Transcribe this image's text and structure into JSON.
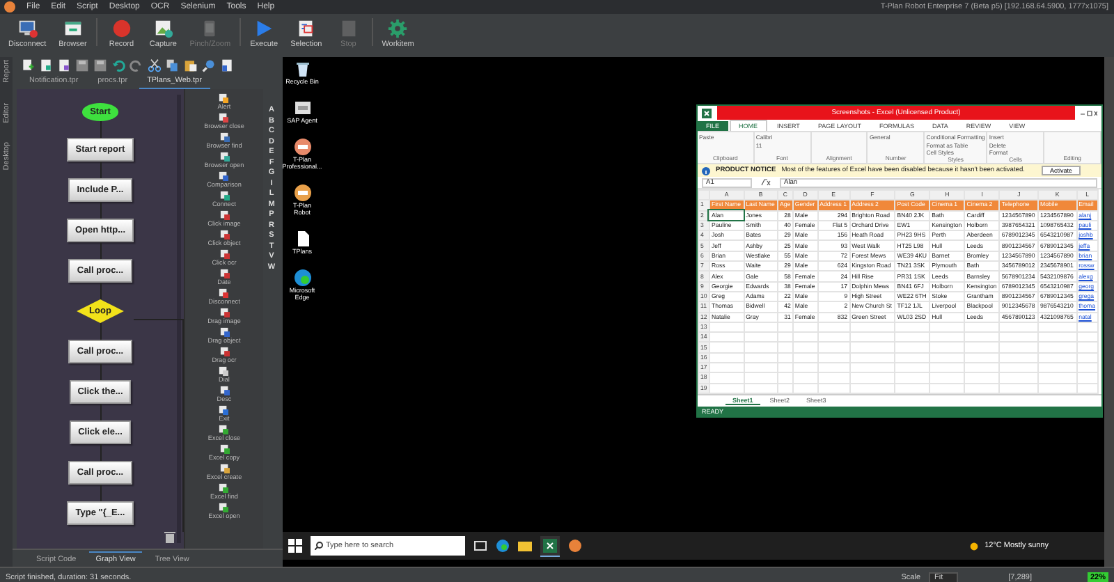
{
  "menu": [
    "File",
    "Edit",
    "Script",
    "Desktop",
    "OCR",
    "Selenium",
    "Tools",
    "Help"
  ],
  "window_title": "T-Plan Robot Enterprise 7 (Beta p5) [192.168.64.5900, 1777x1075]",
  "toolbar": [
    {
      "label": "Disconnect",
      "disabled": false
    },
    {
      "label": "Browser",
      "disabled": false
    },
    {
      "label": "Record",
      "disabled": false
    },
    {
      "label": "Capture",
      "disabled": false
    },
    {
      "label": "Pinch/Zoom",
      "disabled": true
    },
    {
      "label": "Execute",
      "disabled": false
    },
    {
      "label": "Selection",
      "disabled": false
    },
    {
      "label": "Stop",
      "disabled": true
    },
    {
      "label": "Workitem",
      "disabled": false
    }
  ],
  "side_strip": [
    "Report",
    "Editor",
    "Desktop"
  ],
  "file_tabs": [
    {
      "label": "Notification.tpr",
      "selected": false
    },
    {
      "label": "procs.tpr",
      "selected": false
    },
    {
      "label": "TPlans_Web.tpr",
      "selected": true
    }
  ],
  "flow": [
    {
      "kind": "start",
      "label": "Start"
    },
    {
      "kind": "step",
      "label": "Start report"
    },
    {
      "kind": "step",
      "label": "Include P..."
    },
    {
      "kind": "step",
      "label": "Open http..."
    },
    {
      "kind": "step",
      "label": "Call proc..."
    },
    {
      "kind": "loop",
      "label": "Loop"
    },
    {
      "kind": "step",
      "label": "Call proc..."
    },
    {
      "kind": "step",
      "label": "Click the..."
    },
    {
      "kind": "step",
      "label": "Click ele..."
    },
    {
      "kind": "step",
      "label": "Call proc..."
    },
    {
      "kind": "step",
      "label": "Type \"{_E..."
    }
  ],
  "palette": [
    "Alert",
    "Browser close",
    "Browser find",
    "Browser open",
    "Comparison",
    "Connect",
    "Click image",
    "Click object",
    "Click ocr",
    "Date",
    "Disconnect",
    "Drag image",
    "Drag object",
    "Drag ocr",
    "Dial",
    "Desc",
    "Exit",
    "Excel close",
    "Excel copy",
    "Excel create",
    "Excel find",
    "Excel open"
  ],
  "index_letters": [
    "A",
    "B",
    "C",
    "D",
    "E",
    "F",
    "G",
    "I",
    "L",
    "M",
    "P",
    "R",
    "S",
    "T",
    "V",
    "W"
  ],
  "view_tabs": [
    {
      "label": "Script Code",
      "selected": false
    },
    {
      "label": "Graph View",
      "selected": true
    },
    {
      "label": "Tree View",
      "selected": false
    }
  ],
  "status": "Script finished, duration: 31 seconds.",
  "remote_status": {
    "scale_label": "Scale",
    "scale_value": "Fit",
    "coords": "[7,289]",
    "zoom": "22%"
  },
  "desktop_icons": [
    "Recycle Bin",
    "SAP Agent",
    "T-Plan Professional...",
    "T-Plan Robot",
    "TPlans",
    "Microsoft Edge"
  ],
  "excel": {
    "title": "Screenshots - Excel (Unlicensed Product)",
    "ribbon_tabs": [
      {
        "label": "FILE",
        "selected": false
      },
      {
        "label": "HOME",
        "selected": true
      },
      {
        "label": "INSERT",
        "selected": false
      },
      {
        "label": "PAGE LAYOUT",
        "selected": false
      },
      {
        "label": "FORMULAS",
        "selected": false
      },
      {
        "label": "DATA",
        "selected": false
      },
      {
        "label": "REVIEW",
        "selected": false
      },
      {
        "label": "VIEW",
        "selected": false
      }
    ],
    "ribbon_groups": [
      {
        "label": "Clipboard",
        "items": [
          "Paste"
        ]
      },
      {
        "label": "Font",
        "items": [
          "Calibri",
          "11"
        ]
      },
      {
        "label": "Alignment"
      },
      {
        "label": "Number",
        "items": [
          "General"
        ]
      },
      {
        "label": "Styles",
        "items": [
          "Conditional Formatting",
          "Format as Table",
          "Cell Styles"
        ]
      },
      {
        "label": "Cells",
        "items": [
          "Insert",
          "Delete",
          "Format"
        ]
      },
      {
        "label": "Editing"
      }
    ],
    "notice": {
      "title": "PRODUCT NOTICE",
      "message": "Most of the features of Excel have been disabled because it hasn't been activated.",
      "button": "Activate"
    },
    "name_box": "A1",
    "formula": "Alan",
    "column_letters": [
      "A",
      "B",
      "C",
      "D",
      "E",
      "F",
      "G",
      "H",
      "I",
      "J",
      "K",
      "L"
    ],
    "rows": [
      [
        "First Name",
        "Last Name",
        "Age",
        "Gender",
        "Address 1",
        "Address 2",
        "Post Code",
        "Cinema 1",
        "Cinema 2",
        "Telephone",
        "Mobile",
        "Email"
      ],
      [
        "Alan",
        "Jones",
        "28",
        "Male",
        "294",
        "Brighton Road",
        "BN40 2JK",
        "Bath",
        "Cardiff",
        "1234567890",
        "1234567890",
        "alanj"
      ],
      [
        "Pauline",
        "Smith",
        "40",
        "Female",
        "Flat 5",
        "Orchard Drive",
        "EW1",
        "Kensington",
        "Holborn",
        "3987654321",
        "1098765432",
        "pauli"
      ],
      [
        "Josh",
        "Bates",
        "29",
        "Male",
        "156",
        "Heath Road",
        "PH23 9HS",
        "Perth",
        "Aberdeen",
        "6789012345",
        "6543210987",
        "joshb"
      ],
      [
        "Jeff",
        "Ashby",
        "25",
        "Male",
        "93",
        "West Walk",
        "HT25 L98",
        "Hull",
        "Leeds",
        "8901234567",
        "6789012345",
        "jeffa"
      ],
      [
        "Brian",
        "Westlake",
        "55",
        "Male",
        "72",
        "Forest Mews",
        "WE39 4KU",
        "Barnet",
        "Bromley",
        "1234567890",
        "1234567890",
        "brian"
      ],
      [
        "Ross",
        "Waite",
        "29",
        "Male",
        "624",
        "Kingston Road",
        "TN21 3SK",
        "Plymouth",
        "Bath",
        "3456789012",
        "2345678901",
        "rossw"
      ],
      [
        "Alex",
        "Gale",
        "58",
        "Female",
        "24",
        "Hill Rise",
        "PR31 1SK",
        "Leeds",
        "Barnsley",
        "5678901234",
        "5432109876",
        "alexg"
      ],
      [
        "Georgie",
        "Edwards",
        "38",
        "Female",
        "17",
        "Dolphin Mews",
        "BN41 6FJ",
        "Holborn",
        "Kensington",
        "6789012345",
        "6543210987",
        "georg"
      ],
      [
        "Greg",
        "Adams",
        "22",
        "Male",
        "9",
        "High Street",
        "WE22 6TH",
        "Stoke",
        "Grantham",
        "8901234567",
        "6789012345",
        "grega"
      ],
      [
        "Thomas",
        "Bidwell",
        "42",
        "Male",
        "2",
        "New Church St",
        "TF12 1JL",
        "Liverpool",
        "Blackpool",
        "9012345678",
        "9876543210",
        "thoma"
      ],
      [
        "Natalie",
        "Gray",
        "31",
        "Female",
        "832",
        "Green Street",
        "WL03 2SD",
        "Hull",
        "Leeds",
        "4567890123",
        "4321098765",
        "natal"
      ]
    ],
    "row_numbers": [
      "1",
      "2",
      "3",
      "4",
      "5",
      "6",
      "7",
      "8",
      "9",
      "10",
      "11",
      "12",
      "13",
      "14",
      "15",
      "16",
      "17",
      "18",
      "19"
    ],
    "sheet_tabs": [
      {
        "label": "Sheet1",
        "selected": true
      },
      {
        "label": "Sheet2",
        "selected": false
      },
      {
        "label": "Sheet3",
        "selected": false
      }
    ],
    "status": "READY"
  },
  "taskbar": {
    "search_placeholder": "Type here to search",
    "weather": "12°C Mostly sunny"
  }
}
